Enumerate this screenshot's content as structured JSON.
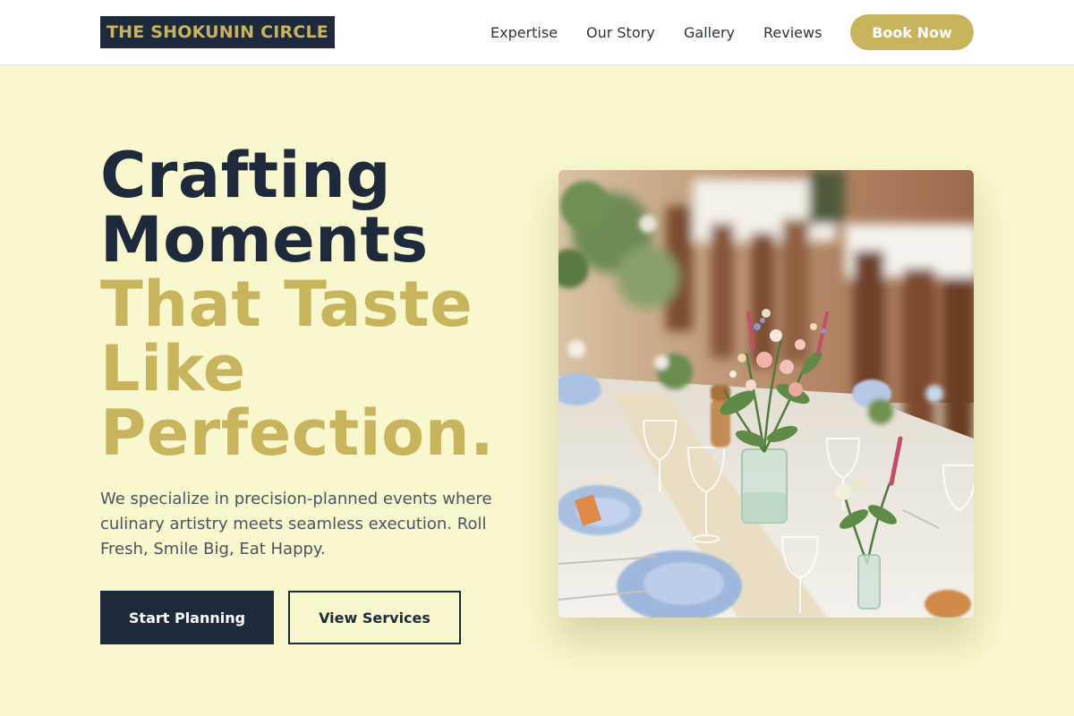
{
  "header": {
    "logo": "THE SHOKUNIN CIRCLE",
    "nav": [
      "Expertise",
      "Our Story",
      "Gallery",
      "Reviews"
    ],
    "cta": "Book Now"
  },
  "hero": {
    "headline_dark": [
      "Crafting",
      "Moments"
    ],
    "headline_gold": [
      "That Taste",
      "Like",
      "Perfection."
    ],
    "description": "We specialize in precision-planned events where culinary artistry meets seamless execution. Roll Fresh, Smile Big, Eat Happy.",
    "primary_button": "Start Planning",
    "secondary_button": "View Services",
    "image_alt": "Wedding table setting with flower arrangements"
  },
  "colors": {
    "navy": "#1e293b",
    "gold": "#c8b45c",
    "background": "#f8f7cd"
  }
}
